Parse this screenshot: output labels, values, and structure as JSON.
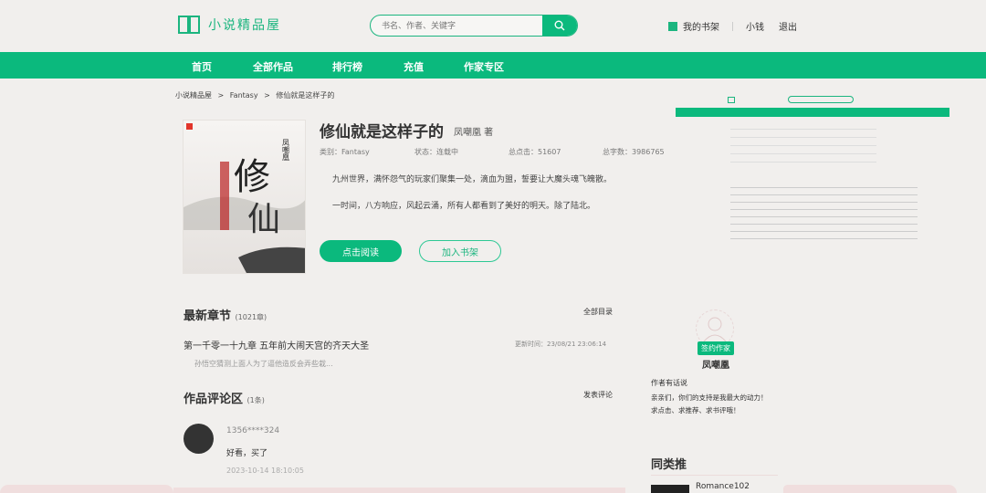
{
  "header": {
    "site_name": "小说精品屋",
    "search_placeholder": "书名、作者、关键字",
    "bookshelf": "我的书架",
    "user": "小钱",
    "logout": "退出"
  },
  "nav": [
    "首页",
    "全部作品",
    "排行榜",
    "充值",
    "作家专区"
  ],
  "breadcrumb": {
    "home": "小说精品屋",
    "sep": ">",
    "category": "Fantasy",
    "current": "修仙就是这样子的"
  },
  "book": {
    "title": "修仙就是这样子的",
    "author": "凤嘲凰 著",
    "category": "类别：Fantasy",
    "status": "状态：连载中",
    "clicks": "总点击：51607",
    "words": "总字数：3986765",
    "desc1": "九州世界，满怀怨气的玩家们聚集一处，滴血为盟，誓要让大魔头魂飞魄散。",
    "desc2": "一时间，八方响应，风起云涌，所有人都看到了美好的明天。除了陆北。",
    "read_btn": "点击阅读",
    "shelf_btn": "加入书架"
  },
  "chapters": {
    "title": "最新章节",
    "count": "(1021章)",
    "all_link": "全部目录",
    "latest": "第一千零一十九章 五年前大闹天宫的齐天大圣",
    "updated": "更新时间：23/08/21 23:06:14",
    "preview": "孙悟空猜测上面人为了逼他造反会弄些栽..."
  },
  "comments": {
    "title": "作品评论区",
    "count": "(1条)",
    "post_link": "发表评论",
    "items": [
      {
        "user": "1356****324",
        "text": "好看，买了",
        "time": "2023-10-14 18:10:05"
      }
    ]
  },
  "sidebar": {
    "badge": "签约作家",
    "author": "凤嘲凰",
    "notes_title": "作者有话说",
    "note1": "亲亲们，你们的支持是我最大的动力！",
    "note2": "求点击、求推荐、求书评哦！",
    "similar_title": "同类推",
    "similar_book": "Romance102"
  },
  "colors": {
    "accent": "#0bb97d"
  }
}
